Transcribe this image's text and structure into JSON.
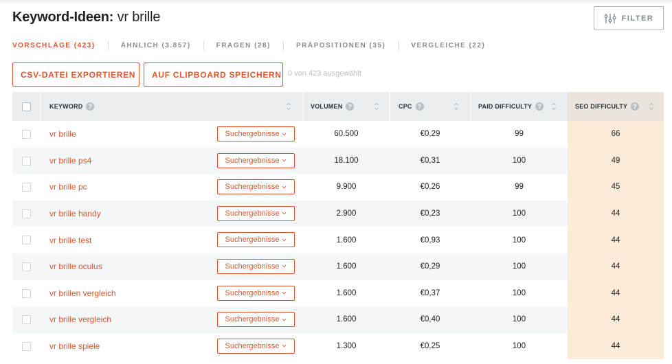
{
  "header": {
    "title_bold": "Keyword-Ideen:",
    "title_query": "vr brille",
    "filter_label": "FILTER"
  },
  "tabs": [
    {
      "label": "VORSCHLÄGE (423)",
      "active": true
    },
    {
      "label": "ÄHNLICH (3.857)",
      "active": false
    },
    {
      "label": "FRAGEN (28)",
      "active": false
    },
    {
      "label": "PRÄPOSITIONEN (35)",
      "active": false
    },
    {
      "label": "VERGLEICHE (22)",
      "active": false
    }
  ],
  "toolbar": {
    "csv_label": "CSV-DATEI EXPORTIEREN",
    "clipboard_label": "AUF CLIPBOARD SPEICHERN",
    "selection_text": "0 von 423 ausgewählt"
  },
  "table": {
    "columns": {
      "keyword": "KEYWORD",
      "volume": "VOLUMEN",
      "cpc": "CPC",
      "paid": "PAID DIFFICULTY",
      "seo": "SEO DIFFICULTY",
      "help": "?"
    },
    "serp_label": "Suchergebnisse",
    "rows": [
      {
        "keyword": "vr brille",
        "volume": "60.500",
        "cpc": "€0,29",
        "paid": "99",
        "seo": "66"
      },
      {
        "keyword": "vr brille ps4",
        "volume": "18.100",
        "cpc": "€0,31",
        "paid": "100",
        "seo": "49"
      },
      {
        "keyword": "vr brille pc",
        "volume": "9.900",
        "cpc": "€0,26",
        "paid": "99",
        "seo": "45"
      },
      {
        "keyword": "vr brille handy",
        "volume": "2.900",
        "cpc": "€0,23",
        "paid": "100",
        "seo": "44"
      },
      {
        "keyword": "vr brille test",
        "volume": "1.600",
        "cpc": "€0,93",
        "paid": "100",
        "seo": "44"
      },
      {
        "keyword": "vr brille oculus",
        "volume": "1.600",
        "cpc": "€0,29",
        "paid": "100",
        "seo": "44"
      },
      {
        "keyword": "vr brillen vergleich",
        "volume": "1.600",
        "cpc": "€0,37",
        "paid": "100",
        "seo": "44"
      },
      {
        "keyword": "vr brille vergleich",
        "volume": "1.600",
        "cpc": "€0,40",
        "paid": "100",
        "seo": "44"
      },
      {
        "keyword": "vr brille spiele",
        "volume": "1.300",
        "cpc": "€0,25",
        "paid": "100",
        "seo": "44"
      }
    ]
  },
  "colors": {
    "accent": "#e0542b",
    "header_bg": "#ebeef0",
    "seo_column_bg": "#fcebd9",
    "row_alt_bg": "#f4f7f8"
  },
  "icons": {
    "filter": "sliders-icon",
    "dropdown": "chevron-down-icon",
    "sort": "sort-arrows-icon",
    "help": "question-circle-icon"
  }
}
